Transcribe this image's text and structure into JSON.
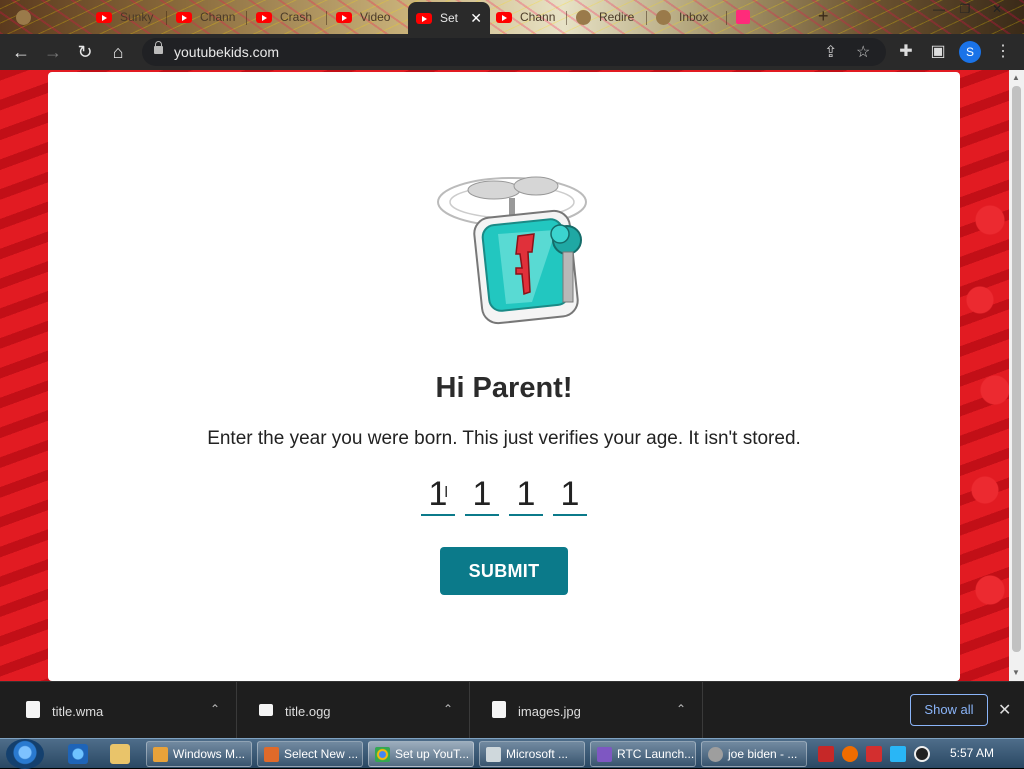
{
  "browser": {
    "tabs": [
      {
        "label": "",
        "icon": "generic"
      },
      {
        "label": "Sunky",
        "icon": "youtube"
      },
      {
        "label": "Chann",
        "icon": "youtube"
      },
      {
        "label": "Crash",
        "icon": "youtube"
      },
      {
        "label": "Video",
        "icon": "youtube"
      },
      {
        "label": "Set",
        "icon": "youtube",
        "active": true
      },
      {
        "label": "Chann",
        "icon": "youtube"
      },
      {
        "label": "Redire",
        "icon": "generic"
      },
      {
        "label": "Inbox",
        "icon": "generic"
      },
      {
        "label": "",
        "icon": "download"
      }
    ],
    "url": "youtubekids.com",
    "profile_initial": "S"
  },
  "page": {
    "greeting": "Hi Parent!",
    "instruction": "Enter the year you were born. This just verifies your age. It isn't stored.",
    "year_digits": [
      "1",
      "1",
      "1",
      "1"
    ],
    "submit_label": "SUBMIT",
    "accent_color": "#0b7a8a",
    "background_color": "#d9141c"
  },
  "downloads": {
    "items": [
      {
        "name": "title.wma"
      },
      {
        "name": "title.ogg"
      },
      {
        "name": "images.jpg"
      }
    ],
    "show_all_label": "Show all"
  },
  "taskbar": {
    "tasks": [
      {
        "label": "Windows M...",
        "color": "#e8a23a"
      },
      {
        "label": "Select New ...",
        "color": "#e06a2a"
      },
      {
        "label": "Set up YouT...",
        "color": "#34a853",
        "active": true
      },
      {
        "label": "Microsoft ...",
        "color": "#cfd8dc"
      },
      {
        "label": "RTC Launch...",
        "color": "#7e57c2"
      },
      {
        "label": "joe biden - ...",
        "color": "#9e9e9e"
      }
    ],
    "clock": "5:57 AM"
  }
}
